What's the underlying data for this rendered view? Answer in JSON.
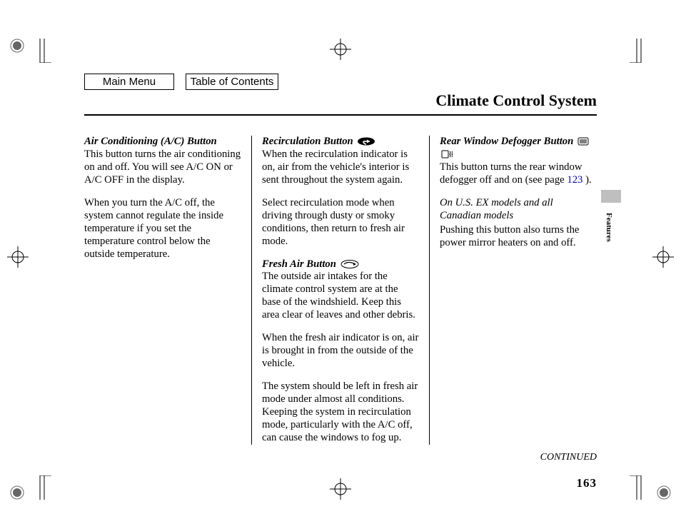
{
  "nav": {
    "main_menu": "Main Menu",
    "toc": "Table of Contents"
  },
  "title": "Climate Control System",
  "side_tab": "Features",
  "continued": "CONTINUED",
  "page_number": "163",
  "col1": {
    "h1": "Air Conditioning (A/C) Button",
    "p1": "This button turns the air conditioning on and off. You will see A/C ON or A/C OFF in the display.",
    "p2": "When you turn the A/C off, the system cannot regulate the inside temperature if you set the temperature control below the outside temperature."
  },
  "col2": {
    "h1": "Recirculation Button",
    "p1": "When the recirculation indicator is on, air from the vehicle's interior is sent throughout the system again.",
    "p2": "Select recirculation mode when driving through dusty or smoky conditions, then return to fresh air mode.",
    "h2": "Fresh Air Button",
    "p3": "The outside air intakes for the climate control system are at the base of the windshield. Keep this area clear of leaves and other debris.",
    "p4": "When the fresh air indicator is on, air is brought in from the outside of the vehicle.",
    "p5": "The system should be left in fresh air mode under almost all conditions. Keeping the system in recirculation mode, particularly with the A/C off, can cause the windows to fog up."
  },
  "col3": {
    "h1": "Rear Window Defogger Button",
    "p1a": "This button turns the rear window defogger off and on (see page ",
    "p1_link": "123",
    "p1b": " ).",
    "note": "On U.S. EX models and all Canadian models",
    "p2": "Pushing this button also turns the power mirror heaters on and off."
  }
}
